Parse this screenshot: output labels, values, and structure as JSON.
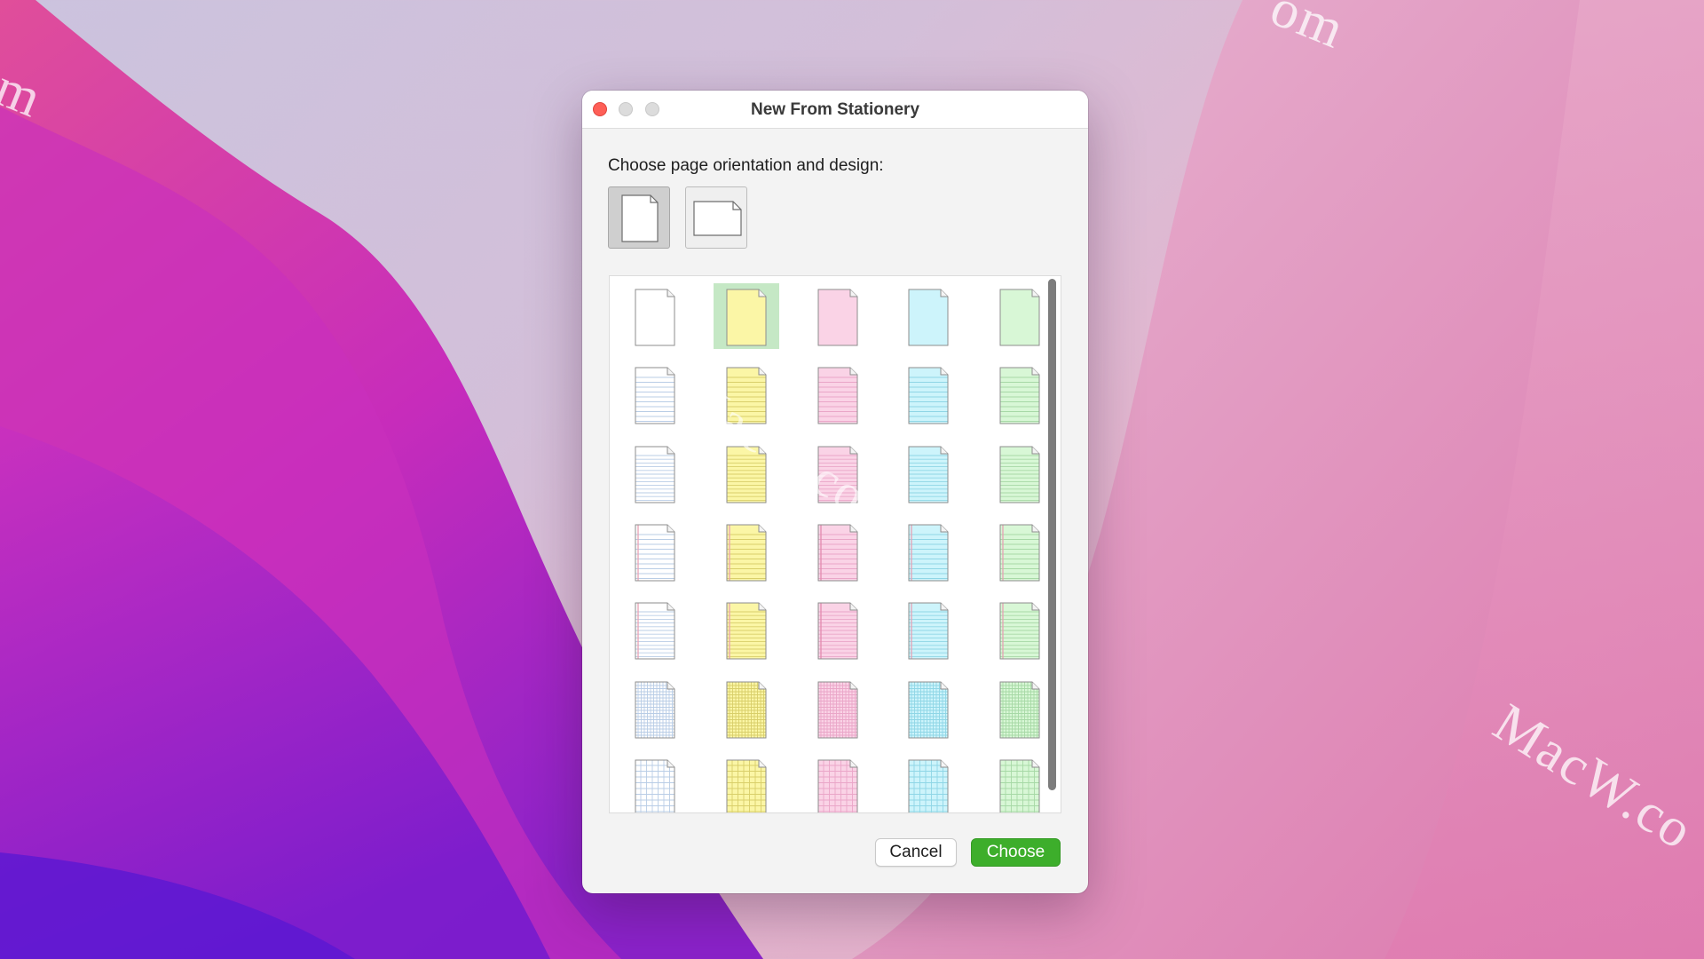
{
  "dialog": {
    "title": "New From Stationery",
    "prompt": "Choose page orientation and design:",
    "orientations": [
      {
        "name": "portrait",
        "selected": true
      },
      {
        "name": "landscape",
        "selected": false
      }
    ],
    "buttons": {
      "cancel": "Cancel",
      "choose": "Choose"
    }
  },
  "stationery": {
    "colors": [
      {
        "name": "white",
        "fill": "#ffffff",
        "line": "#b9cde6",
        "margin": "#e7a2b4"
      },
      {
        "name": "yellow",
        "fill": "#fbf6a6",
        "line": "#d9cf6a",
        "margin": "#e7a2b4"
      },
      {
        "name": "pink",
        "fill": "#fad3e6",
        "line": "#eaa6c8",
        "margin": "#e38aaf"
      },
      {
        "name": "blue",
        "fill": "#cdf4fb",
        "line": "#8fd6e6",
        "margin": "#e7a2b4"
      },
      {
        "name": "green",
        "fill": "#d8f7d6",
        "line": "#a7d9a6",
        "margin": "#e7a2b4"
      }
    ],
    "row_styles": [
      "blank",
      "ruled-wide",
      "ruled-narrow",
      "margin-ruled",
      "margin-ruled-dense",
      "graph-small",
      "graph-large"
    ],
    "selected": {
      "row": 0,
      "col": 1
    }
  },
  "watermarks": [
    "m",
    "om",
    "MacW.com",
    "MacW.co"
  ]
}
